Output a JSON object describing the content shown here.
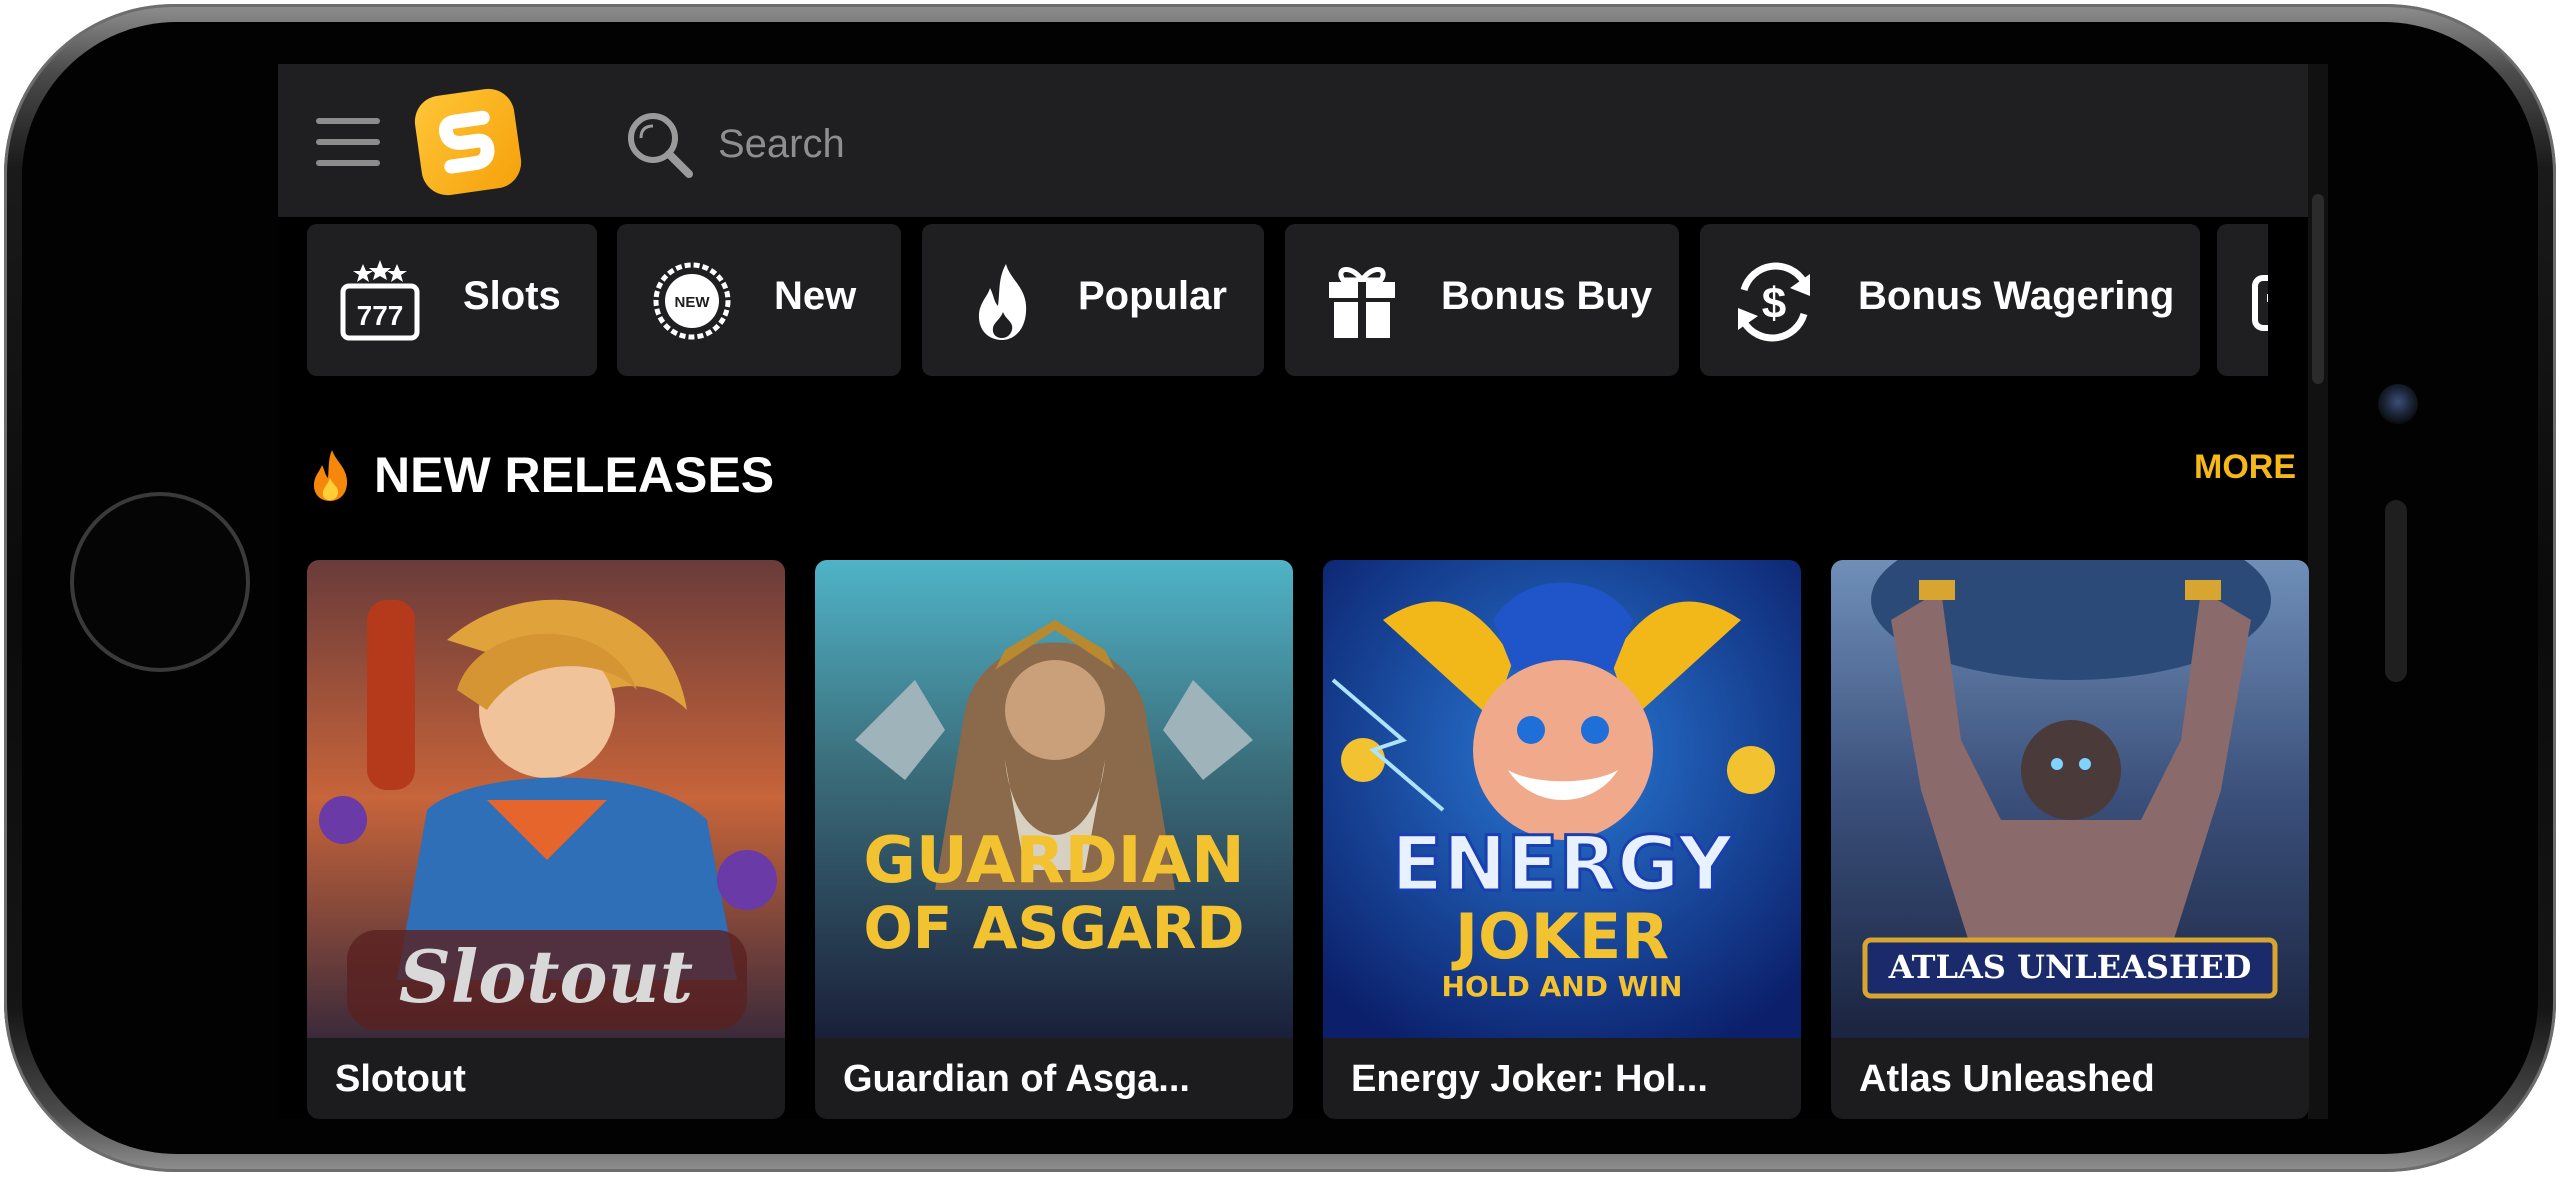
{
  "header": {
    "search_placeholder": "Search"
  },
  "categories": [
    {
      "label": "Slots",
      "icon": "slot-machine-777-icon"
    },
    {
      "label": "New",
      "icon": "new-badge-icon"
    },
    {
      "label": "Popular",
      "icon": "flame-icon"
    },
    {
      "label": "Bonus Buy",
      "icon": "gift-icon"
    },
    {
      "label": "Bonus Wagering",
      "icon": "dollar-cycle-icon"
    }
  ],
  "section": {
    "title": "NEW RELEASES",
    "more_label": "MORE"
  },
  "games": [
    {
      "name": "Slotout",
      "art_title": "Slotout"
    },
    {
      "name": "Guardian of Asga...",
      "art_title_line1": "GUARDIAN",
      "art_title_line2": "OF ASGARD"
    },
    {
      "name": "Energy Joker: Hol...",
      "art_title_line1": "ENERGY",
      "art_title_line2": "JOKER",
      "art_title_line3": "HOLD AND WIN"
    },
    {
      "name": "Atlas Unleashed",
      "art_title": "ATLAS UNLEASHED"
    }
  ],
  "colors": {
    "accent": "#f6b718",
    "background": "#000000",
    "surface": "#1f1f21",
    "logo": "#ffc637"
  }
}
